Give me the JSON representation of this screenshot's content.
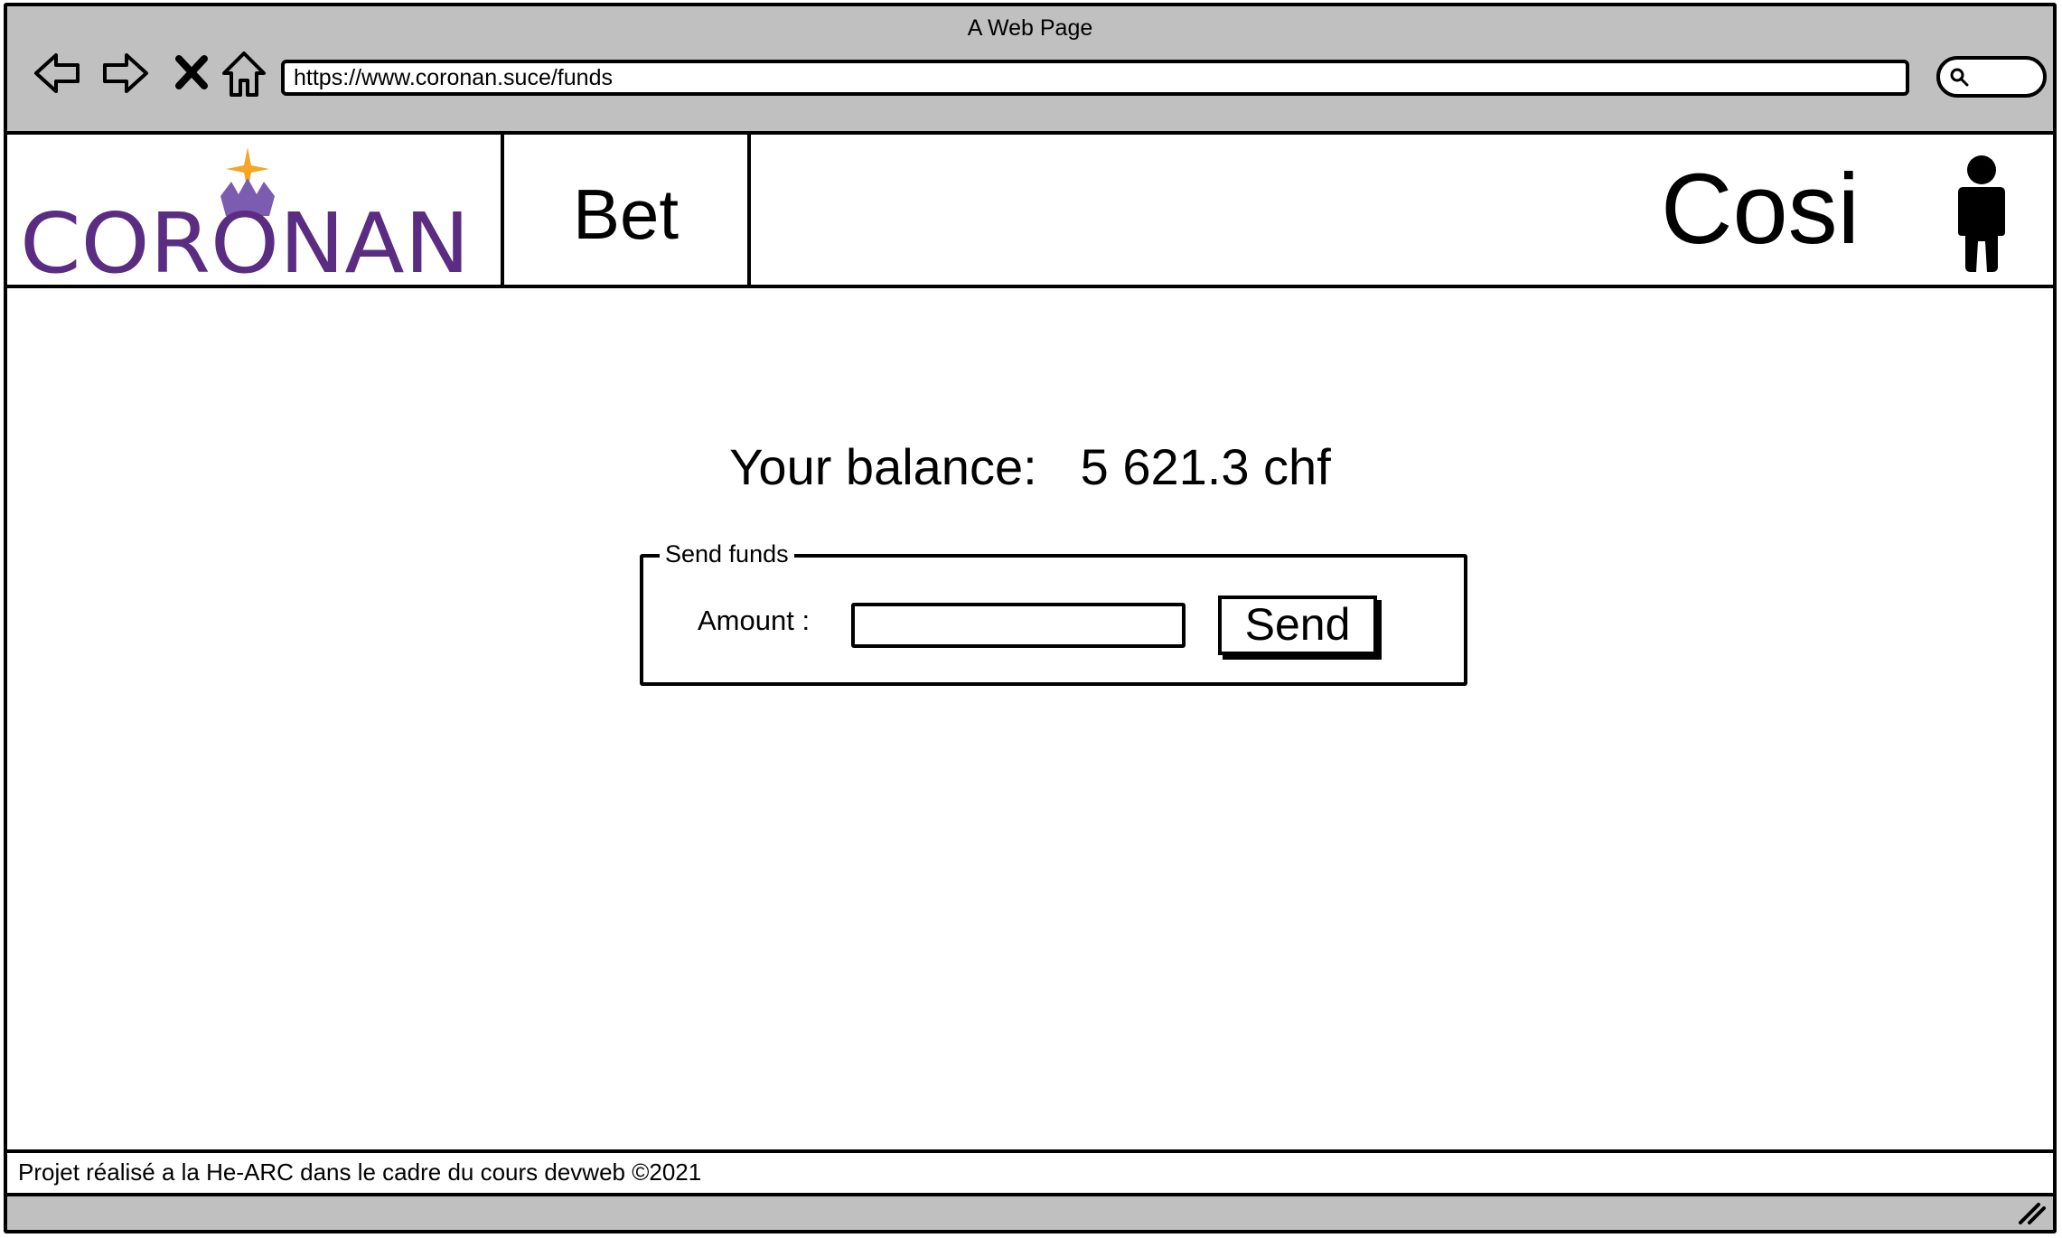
{
  "browser": {
    "window_title": "A Web Page",
    "url": "https://www.coronan.suce/funds",
    "nav_icons": [
      "back-arrow-icon",
      "forward-arrow-icon",
      "close-icon",
      "home-icon"
    ],
    "search_icon": "search-icon",
    "chrome_color": "#c0c0c0"
  },
  "header": {
    "logo_text": "CORONAN",
    "logo_color": "#5a2d82",
    "star_color": "#f5a623",
    "nav_item": "Bet",
    "user_name": "Cosi",
    "user_icon": "user-icon"
  },
  "main": {
    "balance_label": "Your balance:",
    "balance_value": "5 621.3 chf",
    "send_panel": {
      "legend": "Send funds",
      "amount_label": "Amount :",
      "amount_value": "",
      "send_label": "Send"
    }
  },
  "footer": {
    "text": "Projet réalisé a la He-ARC dans le cadre du cours devweb ©2021"
  }
}
